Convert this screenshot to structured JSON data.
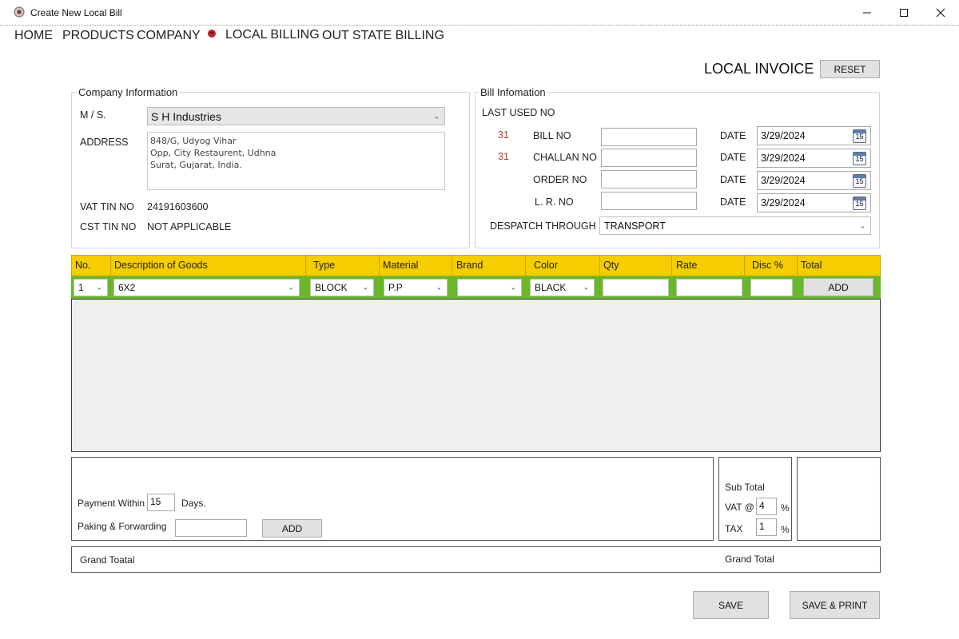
{
  "window": {
    "title": "Create New Local Bill"
  },
  "nav": [
    "HOME",
    "PRODUCTS",
    "COMPANY",
    "LOCAL BILLING",
    "OUT STATE BILLING"
  ],
  "header": {
    "title": "LOCAL INVOICE",
    "reset_label": "RESET"
  },
  "company": {
    "legend": "Company Information",
    "ms_label": "M / S.",
    "ms_value": "S H Industries",
    "address_label": "ADDRESS",
    "address_value": "848/G, Udyog Vihar\nOpp, City Restaurent, Udhna\nSurat, Gujarat, India.",
    "vat_label": "VAT TIN NO",
    "vat_value": "24191603600",
    "cst_label": "CST TIN NO",
    "cst_value": "NOT APPLICABLE"
  },
  "bill": {
    "legend": "Bill Infomation",
    "last_used_label": "LAST USED NO",
    "rows": [
      {
        "last": "31",
        "label": "BILL NO",
        "value": "",
        "date_label": "DATE",
        "date": "3/29/2024"
      },
      {
        "last": "31",
        "label": "CHALLAN NO",
        "value": "",
        "date_label": "DATE",
        "date": "3/29/2024"
      },
      {
        "last": "",
        "label": "ORDER NO",
        "value": "",
        "date_label": "DATE",
        "date": "3/29/2024"
      },
      {
        "last": "",
        "label": "L. R. NO",
        "value": "",
        "date_label": "DATE",
        "date": "3/29/2024"
      }
    ],
    "calendar_day": "15",
    "despatch_label": "DESPATCH THROUGH",
    "despatch_value": "TRANSPORT"
  },
  "table": {
    "headers": [
      "No.",
      "Description of Goods",
      "Type",
      "Material",
      "Brand",
      "Color",
      "Qty",
      "Rate",
      "Disc %",
      "Total"
    ],
    "entry": {
      "no": "1",
      "description": "6X2",
      "type": "BLOCK",
      "material": "P.P",
      "brand": "",
      "color": "BLACK",
      "qty": "",
      "rate": "",
      "disc": "",
      "add_label": "ADD"
    },
    "header_color": "#f5cd00",
    "entry_row_color": "#6ab82a"
  },
  "footer": {
    "payment_label": "Payment Within",
    "payment_days": "15",
    "days_label": "Days.",
    "packing_label": "Paking & Forwarding",
    "packing_value": "",
    "add_label": "ADD",
    "subtotal_label": "Sub Total",
    "vat_label": "VAT @",
    "vat_value": "4",
    "tax_label": "TAX",
    "tax_value": "1",
    "percent": "%",
    "grand_left_label": "Grand Toatal",
    "grand_right_label": "Grand Total",
    "save_label": "SAVE",
    "save_print_label": "SAVE & PRINT"
  }
}
